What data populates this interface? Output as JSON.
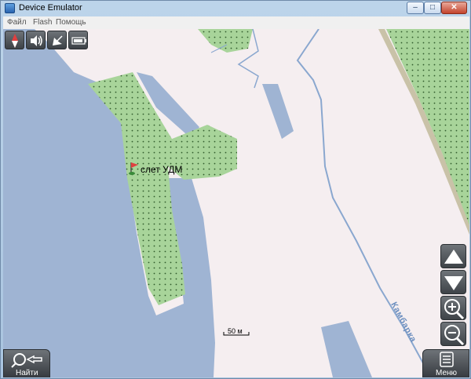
{
  "window": {
    "title": "Device Emulator",
    "minimize": "–",
    "maximize": "□",
    "close": "✕"
  },
  "menubar": {
    "items": [
      "Файл",
      "Flash",
      "Помощь"
    ]
  },
  "toolbar": {
    "icons": [
      "compass-icon",
      "speaker-icon",
      "satellite-icon",
      "battery-icon"
    ]
  },
  "map": {
    "poi_label": "слет УДМ",
    "river_label": "Камбарка",
    "scale_label": "50 м",
    "colors": {
      "land": "#f5eef0",
      "water": "#9fb4d3",
      "forest": "#a8d49a",
      "road": "#c9c2a8",
      "river": "#8aa7cf"
    }
  },
  "controls": {
    "side_buttons": [
      "scroll-up-icon",
      "scroll-down-icon",
      "zoom-in-icon",
      "zoom-out-icon"
    ],
    "find_label": "Найти",
    "menu_label": "Меню"
  }
}
